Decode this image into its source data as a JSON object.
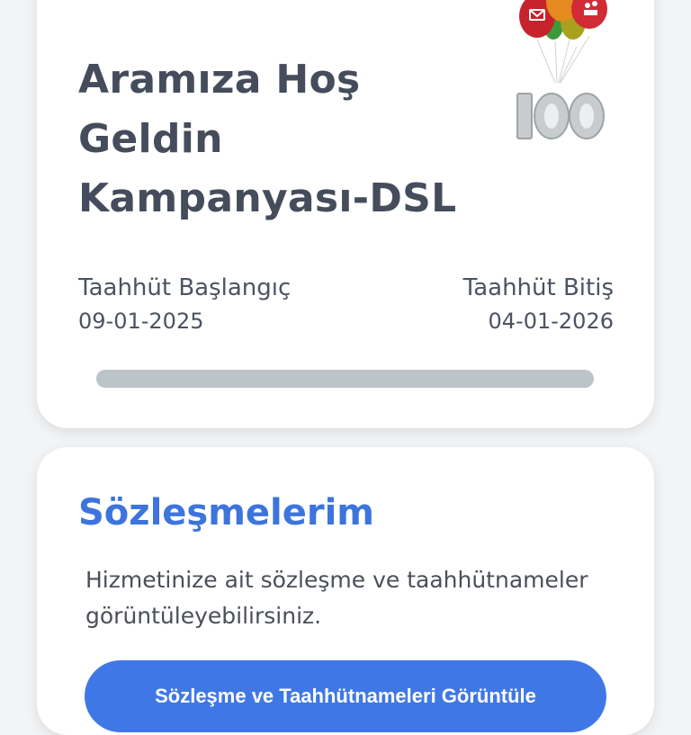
{
  "campaign": {
    "title": "Aramıza Hoş Geldin Kampanyası-DSL",
    "illustration_icon": "balloons-100-icon",
    "start_label": "Taahhüt Başlangıç",
    "start_date": "09-01-2025",
    "end_label": "Taahhüt Bitiş",
    "end_date": "04-01-2026",
    "progress_fraction": 0.0
  },
  "contracts": {
    "title": "Sözleşmelerim",
    "description": "Hizmetinize ait sözleşme ve taahhütnameler görüntüleyebilirsiniz.",
    "button_label": "Sözleşme ve Taahhütnameleri Görüntüle"
  },
  "colors": {
    "accent": "#3f78e6",
    "title_text": "#454c5c",
    "progress_track": "#bac4c9"
  }
}
